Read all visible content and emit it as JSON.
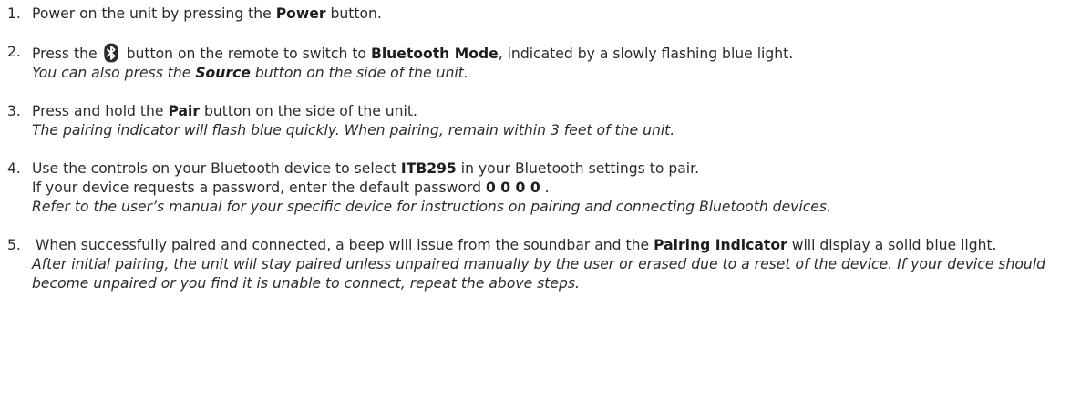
{
  "steps": [
    {
      "number": "1.",
      "t1": "Power on the unit by pressing the ",
      "b1": "Power",
      "t2": " button."
    },
    {
      "number": "2.",
      "t1": "Press the",
      "icon": "bluetooth-icon",
      "t2": "button on the remote to switch to ",
      "b1": "Bluetooth Mode",
      "t3": ", indicated by a slowly flashing blue light.",
      "note_t1": "You can also press the ",
      "note_b1": "Source",
      "note_t2": " button on the side of the unit."
    },
    {
      "number": "3.",
      "t1": "Press and hold the ",
      "b1": "Pair",
      "t2": " button on the side of the unit.",
      "note": "The pairing indicator will flash blue quickly. When pairing, remain within 3 feet of the unit."
    },
    {
      "number": "4.",
      "t1": "Use the controls on your Bluetooth device to select ",
      "b1": "ITB295",
      "t2": " in your Bluetooth settings to pair.",
      "l2_t1": "If your device requests a password, enter the default password ",
      "l2_b1": "0 0 0 0",
      "l2_t2": " .",
      "note": "Refer to the user’s manual for your specific device for instructions on pairing and connecting Bluetooth devices."
    },
    {
      "number": "5.",
      "t1": "When successfully paired and connected, a beep will issue from the soundbar and the ",
      "b1": "Pairing Indicator",
      "t2": " will display a solid blue light.",
      "note": "After initial pairing, the unit will stay paired unless unpaired manually by the user or erased due to a reset of the device. If your device should become unpaired or you find it is unable to connect, repeat the above steps."
    }
  ],
  "colors": {
    "text": "#2b2b2b",
    "icon_fill": "#2b2b2b",
    "icon_glyph": "#ffffff"
  }
}
